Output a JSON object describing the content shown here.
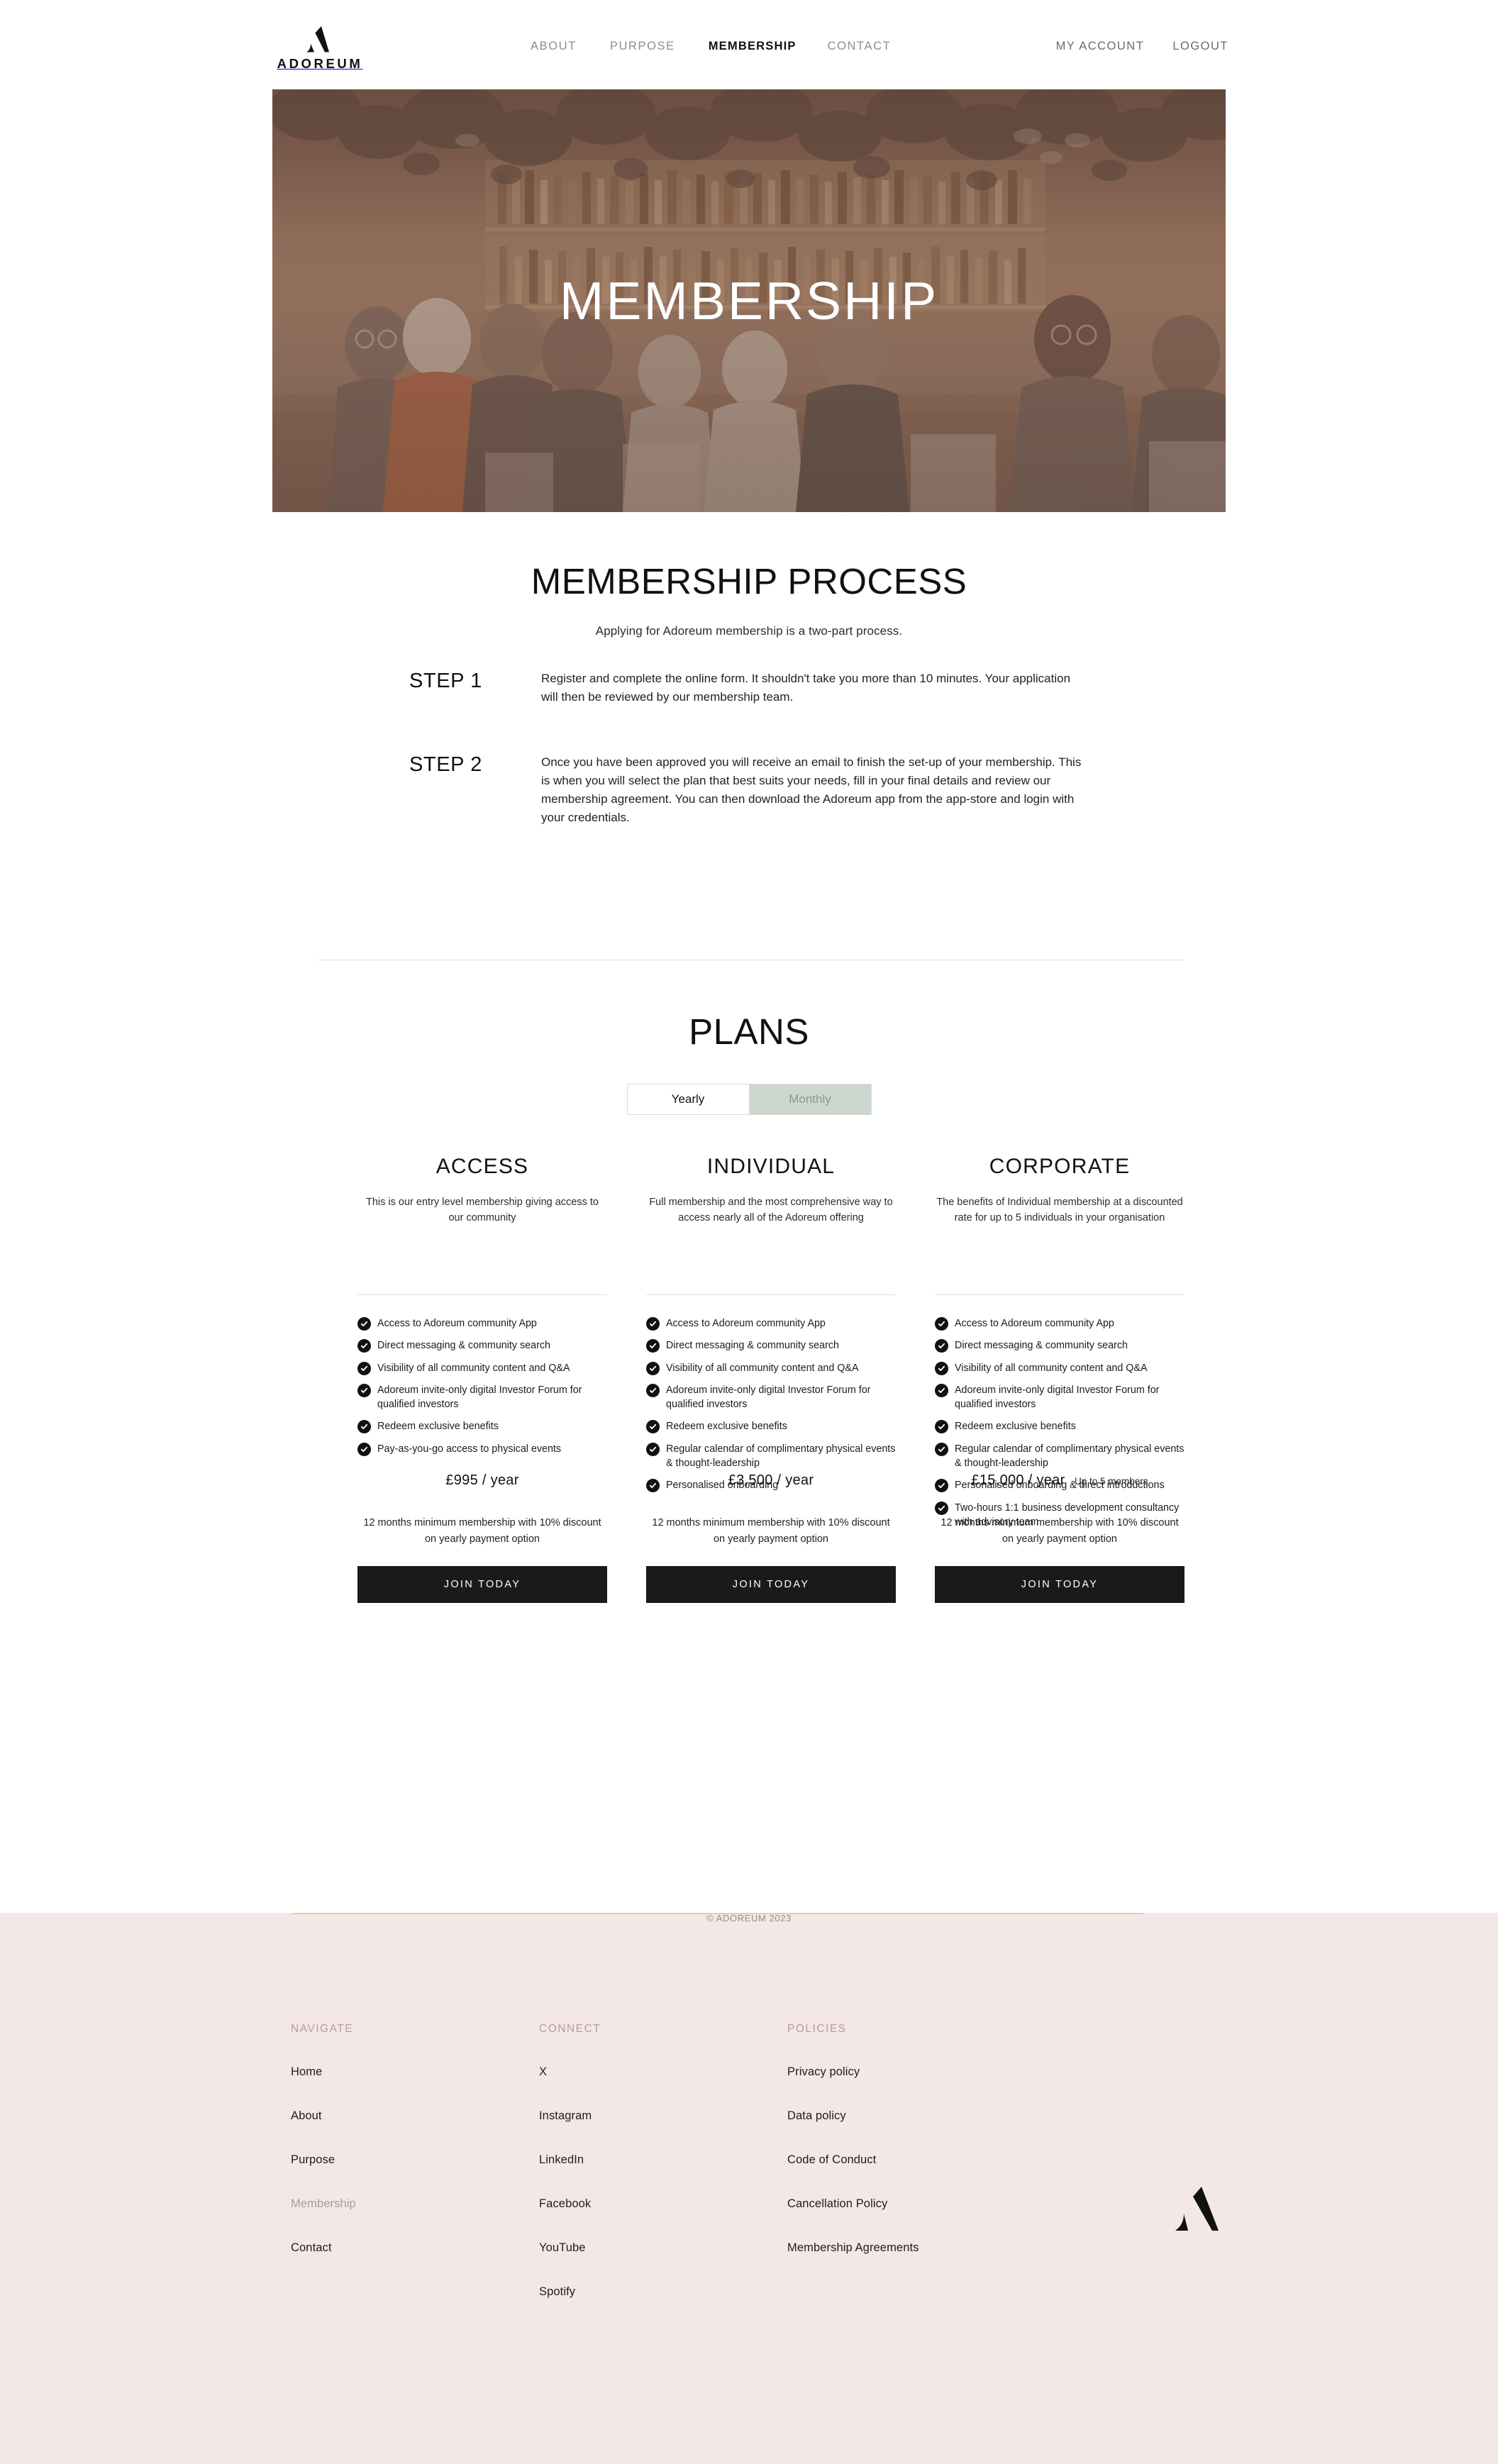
{
  "brand": {
    "name": "ADOREUM",
    "logo_icon": "adoreum-a-mark"
  },
  "header": {
    "nav": [
      {
        "label": "ABOUT",
        "active": false
      },
      {
        "label": "PURPOSE",
        "active": false
      },
      {
        "label": "MEMBERSHIP",
        "active": true
      },
      {
        "label": "CONTACT",
        "active": false
      }
    ],
    "account": [
      {
        "label": "MY ACCOUNT"
      },
      {
        "label": "LOGOUT"
      }
    ]
  },
  "hero": {
    "title": "MEMBERSHIP",
    "image_alt": "people socialising at a bar",
    "overlay_color": "#7a5a4e"
  },
  "process": {
    "heading": "MEMBERSHIP PROCESS",
    "lead": "Applying for Adoreum membership is a two-part process.",
    "steps": [
      {
        "label": "STEP 1",
        "text": "Register and complete the online form. It shouldn't take you more than 10 minutes. Your application will then be reviewed by our membership team."
      },
      {
        "label": "STEP 2",
        "text": "Once you have been approved you will receive an email to finish the set-up of your membership. This is when you will select the plan that best suits your needs, fill in your final details and review our membership agreement.  You can then download the Adoreum app from the app-store and login with your credentials."
      }
    ]
  },
  "plans": {
    "heading": "PLANS",
    "billing_toggle": {
      "options": [
        "Yearly",
        "Monthly"
      ],
      "selected": "Yearly"
    },
    "cta_label": "JOIN TODAY",
    "terms": "12 months minimum membership with 10% discount on yearly payment option",
    "columns": [
      {
        "name": "ACCESS",
        "description": "This is our entry level membership giving access to our community",
        "features": [
          "Access to Adoreum community App",
          "Direct messaging & community search",
          "Visibility of all community content and Q&A",
          "Adoreum invite-only digital Investor Forum for qualified investors",
          "Redeem exclusive benefits",
          "Pay-as-you-go access to physical events"
        ],
        "price": "£995 / year",
        "price_note": "",
        "cta_label": "JOIN TODAY",
        "terms": "12 months minimum membership with 10% discount on yearly payment option"
      },
      {
        "name": "INDIVIDUAL",
        "description": "Full membership and the most comprehensive way to access nearly all of the Adoreum offering",
        "features": [
          "Access to Adoreum community App",
          "Direct messaging & community search",
          "Visibility of all community content and Q&A",
          "Adoreum invite-only digital Investor Forum for qualified investors",
          "Redeem exclusive benefits",
          "Regular calendar of complimentary physical events & thought-leadership",
          "Personalised onboarding"
        ],
        "price": "£3,500 / year",
        "price_note": "",
        "cta_label": "JOIN TODAY",
        "terms": "12 months minimum membership with 10% discount on yearly payment option"
      },
      {
        "name": "CORPORATE",
        "description": "The benefits of Individual membership at a discounted rate for up to 5 individuals in your organisation",
        "features": [
          "Access to Adoreum community App",
          "Direct messaging & community search",
          "Visibility of all community content and Q&A",
          "Adoreum invite-only digital Investor Forum for qualified investors",
          "Redeem exclusive benefits",
          "Regular calendar of complimentary physical events & thought-leadership",
          "Personalised onboarding & direct introductions",
          "Two-hours 1:1 business development consultancy with advisory team"
        ],
        "price": "£15,000 / year",
        "price_note": "Up to 5 members",
        "cta_label": "JOIN TODAY",
        "terms": "12 months minimum membership with 10% discount on yearly payment option"
      }
    ]
  },
  "footer": {
    "background_color": "#f4e8e6",
    "columns": [
      {
        "heading": "NAVIGATE",
        "links": [
          {
            "label": "Home",
            "muted": false
          },
          {
            "label": "About",
            "muted": false
          },
          {
            "label": "Purpose",
            "muted": false
          },
          {
            "label": "Membership",
            "muted": true
          },
          {
            "label": "Contact",
            "muted": false
          }
        ]
      },
      {
        "heading": "CONNECT",
        "links": [
          {
            "label": "X",
            "muted": false
          },
          {
            "label": "Instagram",
            "muted": false
          },
          {
            "label": "LinkedIn",
            "muted": false
          },
          {
            "label": "Facebook",
            "muted": false
          },
          {
            "label": "YouTube",
            "muted": false
          },
          {
            "label": "Spotify",
            "muted": false
          }
        ]
      },
      {
        "heading": "POLICIES",
        "links": [
          {
            "label": "Privacy policy",
            "muted": false
          },
          {
            "label": "Data policy",
            "muted": false
          },
          {
            "label": "Code of Conduct",
            "muted": false
          },
          {
            "label": "Cancellation Policy",
            "muted": false
          },
          {
            "label": "Membership Agreements",
            "muted": false
          }
        ]
      }
    ],
    "copyright": "© ADOREUM 2023"
  }
}
